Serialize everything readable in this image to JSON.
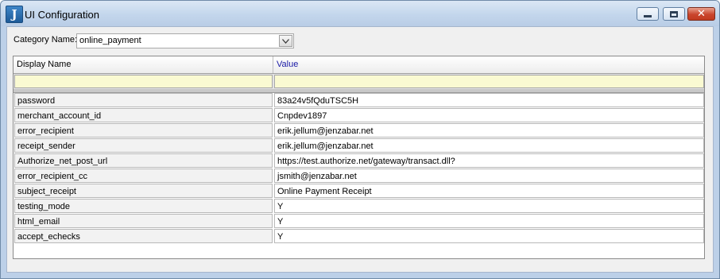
{
  "window": {
    "title": "UI Configuration",
    "icon": "jenzabar-app-icon",
    "controls": [
      "minimize-icon",
      "maximize-icon",
      "close-icon"
    ]
  },
  "category": {
    "label": "Category Name:",
    "value": "online_payment"
  },
  "grid": {
    "columns": [
      "Display Name",
      "Value"
    ],
    "rows": [
      {
        "name": "password",
        "value": "83a24v5fQduTSC5H"
      },
      {
        "name": "merchant_account_id",
        "value": "Cnpdev1897"
      },
      {
        "name": "error_recipient",
        "value": "erik.jellum@jenzabar.net"
      },
      {
        "name": "receipt_sender",
        "value": "erik.jellum@jenzabar.net"
      },
      {
        "name": "Authorize_net_post_url",
        "value": "https://test.authorize.net/gateway/transact.dll?"
      },
      {
        "name": "error_recipient_cc",
        "value": "jsmith@jenzabar.net"
      },
      {
        "name": "subject_receipt",
        "value": "Online Payment Receipt"
      },
      {
        "name": "testing_mode",
        "value": "Y"
      },
      {
        "name": "html_email",
        "value": "Y"
      },
      {
        "name": "accept_echecks",
        "value": "Y"
      }
    ]
  },
  "colors": {
    "filter_row": "#fafad2",
    "value_header_text": "#1a1aa6",
    "close_button": "#c9452c"
  }
}
